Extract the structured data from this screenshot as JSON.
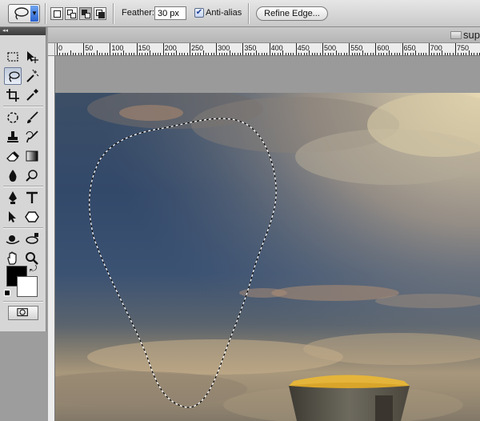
{
  "options_bar": {
    "feather_label": "Feather:",
    "feather_value": "30 px",
    "antialias_label": "Anti-alias",
    "antialias_checked": true,
    "refine_edge_label": "Refine Edge..."
  },
  "document": {
    "title": "sup",
    "ruler_labels": [
      "0",
      "50",
      "100",
      "150",
      "200",
      "250",
      "300",
      "350",
      "400",
      "450",
      "500",
      "550",
      "600",
      "650",
      "700",
      "750"
    ]
  },
  "tools": [
    "marquee-tool",
    "move-tool",
    "lasso-tool",
    "magic-wand-tool",
    "crop-tool",
    "eyedropper-tool",
    "healing-brush-tool",
    "brush-tool",
    "clone-stamp-tool",
    "history-brush-tool",
    "eraser-tool",
    "gradient-tool",
    "blur-tool",
    "dodge-tool",
    "pen-tool",
    "type-tool",
    "path-selection-tool",
    "shape-tool",
    "3d-rotate-tool",
    "3d-orbit-tool",
    "hand-tool",
    "zoom-tool"
  ],
  "colors": {
    "foreground": "#000000",
    "background": "#ffffff",
    "selected_tool": "lasso-tool"
  }
}
